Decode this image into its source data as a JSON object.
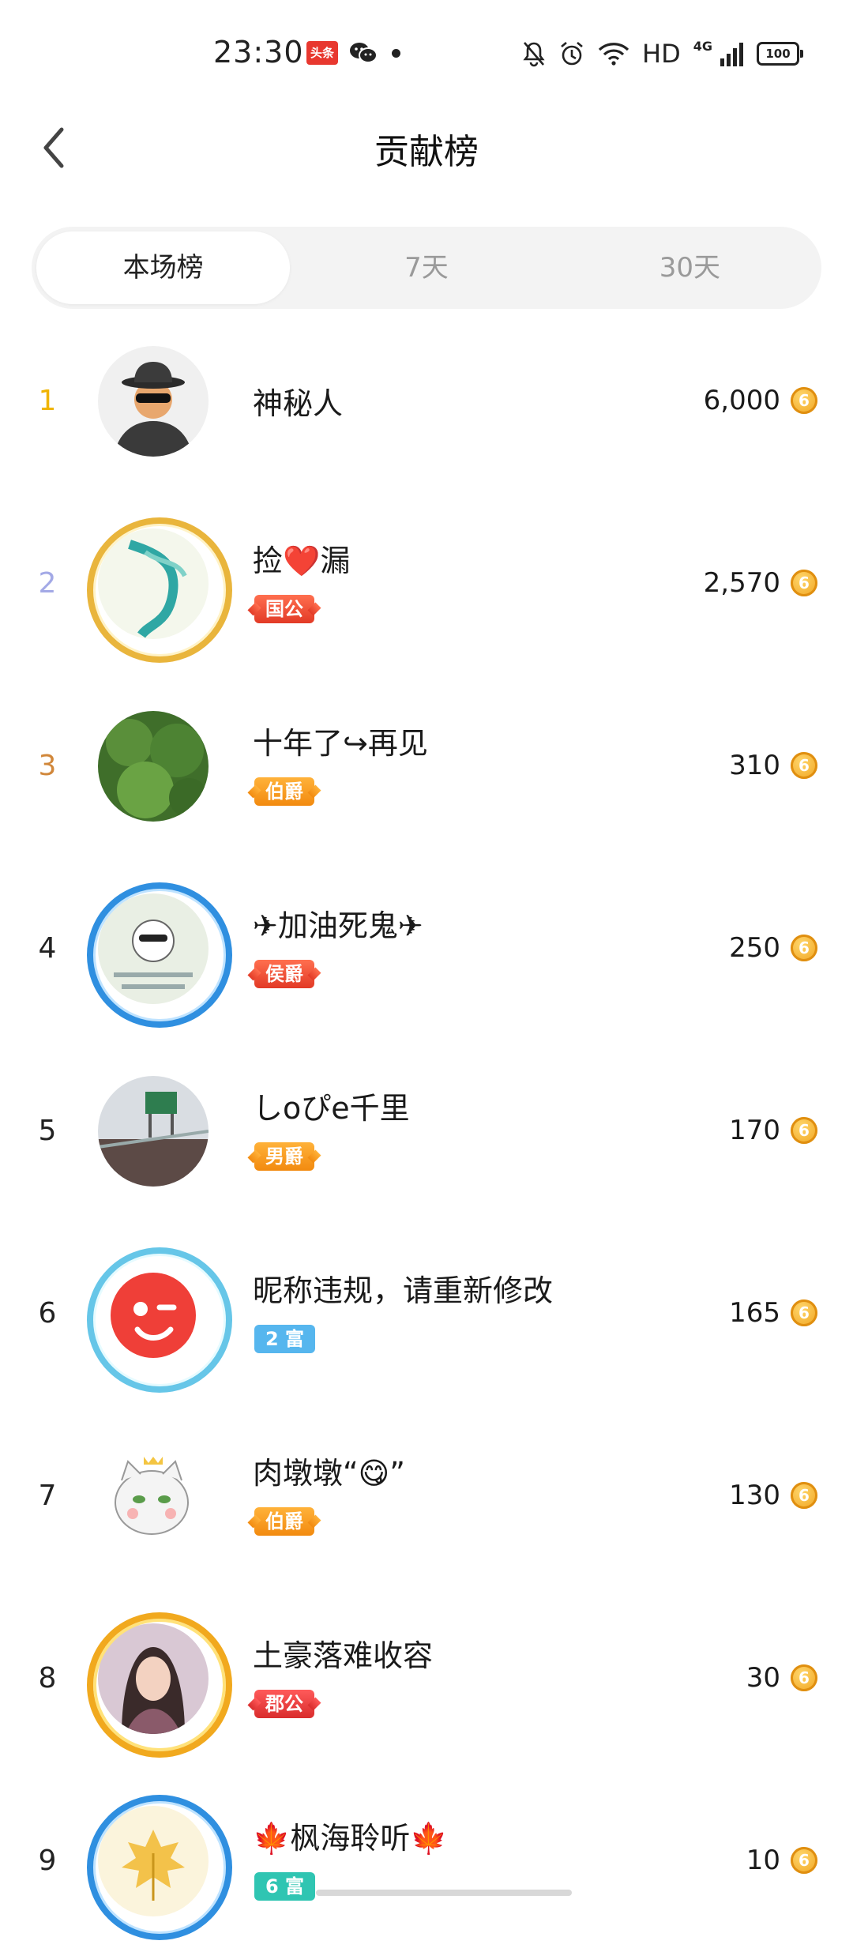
{
  "status_bar": {
    "time": "23:30",
    "app_badge": "头条",
    "network": "HD",
    "signal": "4G",
    "battery": "100",
    "icons": [
      "wechat-icon",
      "notification-dot-icon",
      "mute-bell-icon",
      "alarm-icon",
      "wifi-icon",
      "signal-icon"
    ]
  },
  "header": {
    "title": "贡献榜",
    "back_icon": "chevron-left-icon"
  },
  "tabs": [
    {
      "label": "本场榜",
      "active": true
    },
    {
      "label": "7天",
      "active": false
    },
    {
      "label": "30天",
      "active": false
    }
  ],
  "rank_colors": {
    "1": "#f0b400",
    "2": "#a3a9e6",
    "3": "#d1873a",
    "other": "#222222"
  },
  "entries": [
    {
      "rank": "1",
      "name": "神秘人",
      "badge": "",
      "score": "6,000"
    },
    {
      "rank": "2",
      "name": "捡❤️漏",
      "badge": "国公",
      "score": "2,570"
    },
    {
      "rank": "3",
      "name": "十年了↪再见",
      "badge": "伯爵",
      "score": "310"
    },
    {
      "rank": "4",
      "name": "✈加油死鬼✈",
      "badge": "侯爵",
      "score": "250"
    },
    {
      "rank": "5",
      "name": "しoぴe千里",
      "badge": "男爵",
      "score": "170"
    },
    {
      "rank": "6",
      "name": "昵称违规，请重新修改",
      "badge": "2 富",
      "score": "165"
    },
    {
      "rank": "7",
      "name": "肉墩墩“😋”",
      "badge": "伯爵",
      "score": "130"
    },
    {
      "rank": "8",
      "name": "土豪落难收容",
      "badge": "郡公",
      "score": "30"
    },
    {
      "rank": "9",
      "name": "🍁枫海聆听🍁",
      "badge": "6 富",
      "score": "10"
    }
  ],
  "coin_glyph": "6"
}
